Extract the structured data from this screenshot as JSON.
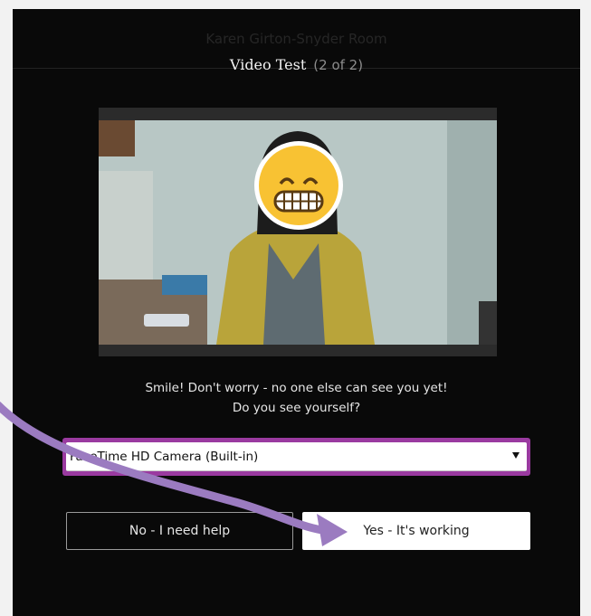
{
  "room": {
    "title": "Karen Girton-Snyder Room"
  },
  "step": {
    "title": "Video Test",
    "counter": "(2 of 2)"
  },
  "video": {
    "overlay": "grimacing-face-emoji"
  },
  "hint": {
    "line1": "Smile! Don't worry - no one else can see you yet!",
    "line2": "Do you see yourself?"
  },
  "camera_select": {
    "value": "FaceTime HD Camera (Built-in)"
  },
  "buttons": {
    "no_label": "No - I need help",
    "yes_label": "Yes - It's working"
  },
  "colors": {
    "panel": "#090909",
    "accent": "#9a3aa0",
    "annotation_arrow": "#9b7bc0"
  }
}
